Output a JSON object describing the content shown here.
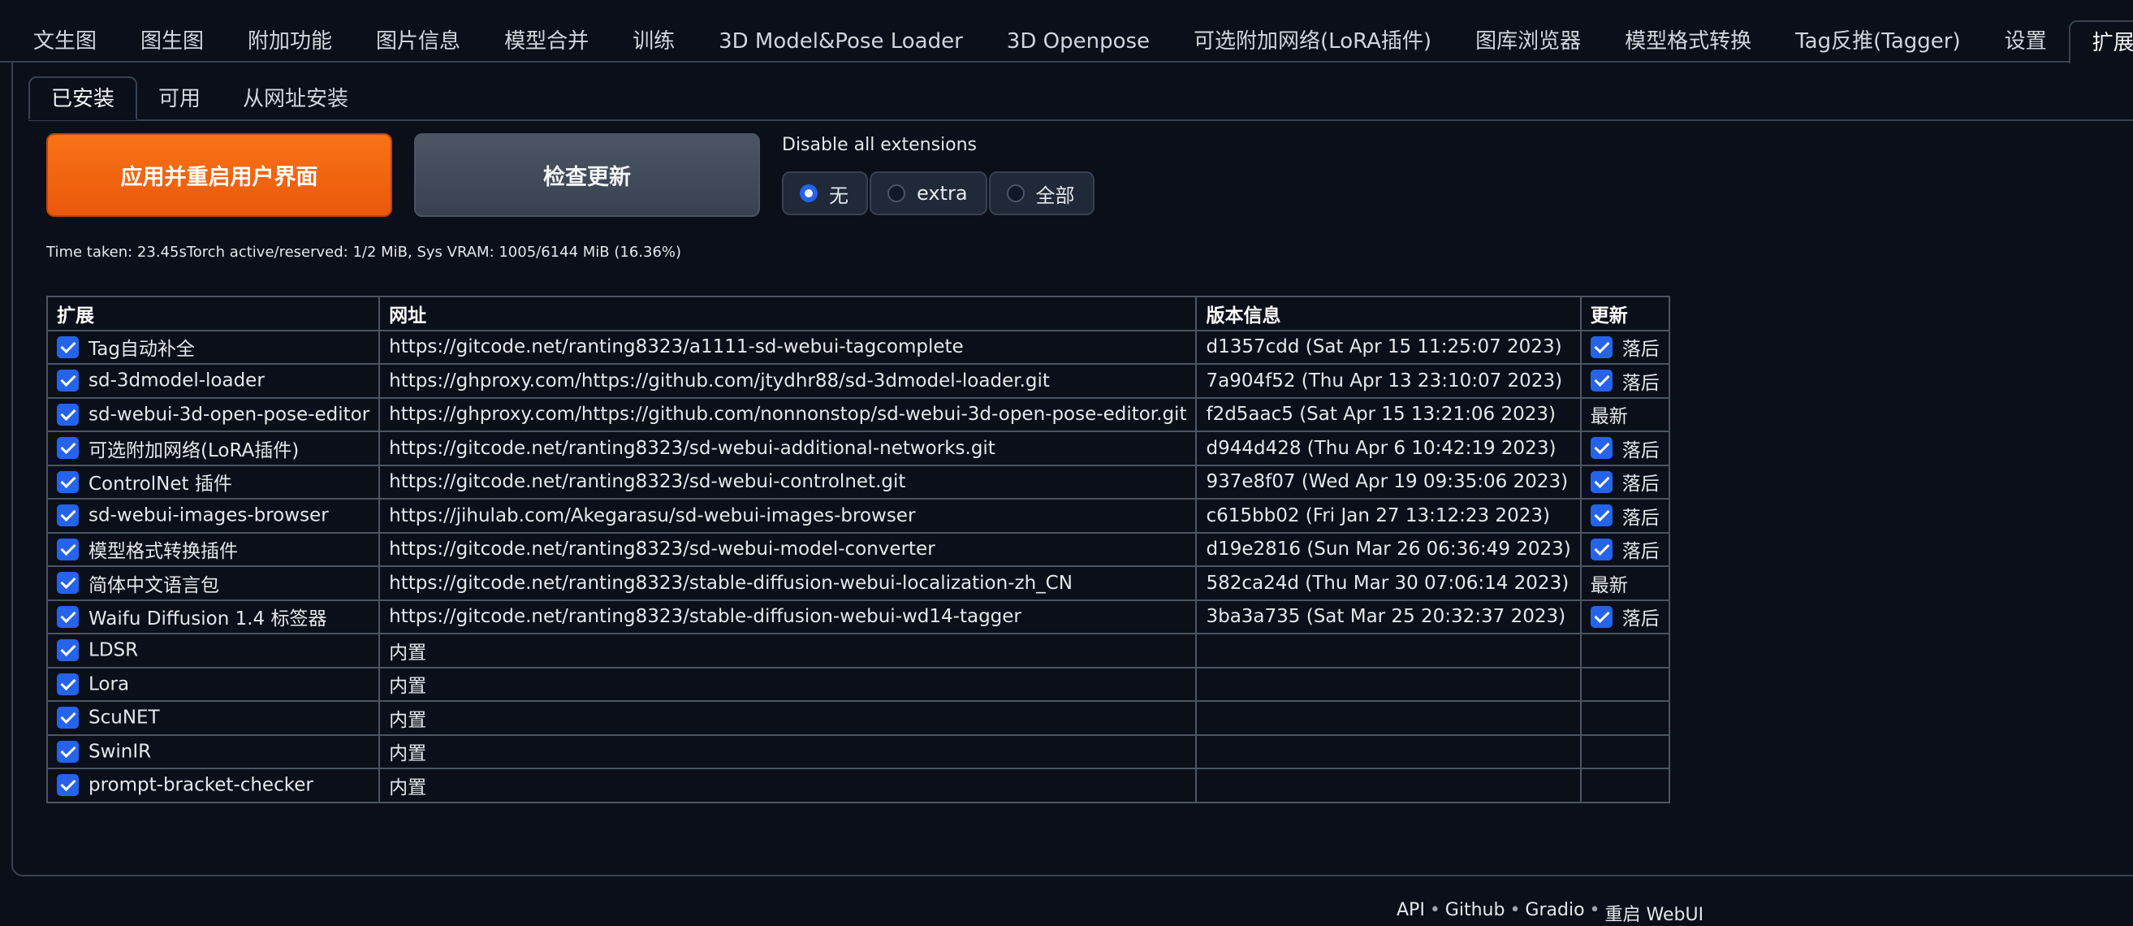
{
  "topnav": {
    "tabs": [
      "文生图",
      "图生图",
      "附加功能",
      "图片信息",
      "模型合并",
      "训练",
      "3D Model&Pose Loader",
      "3D Openpose",
      "可选附加网络(LoRA插件)",
      "图库浏览器",
      "模型格式转换",
      "Tag反推(Tagger)",
      "设置",
      "扩展"
    ],
    "active": "扩展"
  },
  "subnav": {
    "tabs": [
      "已安装",
      "可用",
      "从网址安装"
    ],
    "active": "已安装"
  },
  "buttons": {
    "apply_label": "应用并重启用户界面",
    "check_label": "检查更新"
  },
  "disable": {
    "label": "Disable all extensions",
    "options": [
      "无",
      "extra",
      "全部"
    ],
    "selected": "无"
  },
  "status_text": "Time taken: 23.45sTorch active/reserved: 1/2 MiB, Sys VRAM: 1005/6144 MiB (16.36%)",
  "table": {
    "headers": [
      "扩展",
      "网址",
      "版本信息",
      "更新"
    ],
    "rows": [
      {
        "enabled": true,
        "name": "Tag自动补全",
        "url": "https://gitcode.net/ranting8323/a1111-sd-webui-tagcomplete",
        "version": "d1357cdd (Sat Apr 15 11:25:07 2023)",
        "update_checkbox": true,
        "update": "落后"
      },
      {
        "enabled": true,
        "name": "sd-3dmodel-loader",
        "url": "https://ghproxy.com/https://github.com/jtydhr88/sd-3dmodel-loader.git",
        "version": "7a904f52 (Thu Apr 13 23:10:07 2023)",
        "update_checkbox": true,
        "update": "落后"
      },
      {
        "enabled": true,
        "name": "sd-webui-3d-open-pose-editor",
        "url": "https://ghproxy.com/https://github.com/nonnonstop/sd-webui-3d-open-pose-editor.git",
        "version": "f2d5aac5 (Sat Apr 15 13:21:06 2023)",
        "update_checkbox": false,
        "update": "最新"
      },
      {
        "enabled": true,
        "name": "可选附加网络(LoRA插件)",
        "url": "https://gitcode.net/ranting8323/sd-webui-additional-networks.git",
        "version": "d944d428 (Thu Apr 6 10:42:19 2023)",
        "update_checkbox": true,
        "update": "落后"
      },
      {
        "enabled": true,
        "name": "ControlNet 插件",
        "url": "https://gitcode.net/ranting8323/sd-webui-controlnet.git",
        "version": "937e8f07 (Wed Apr 19 09:35:06 2023)",
        "update_checkbox": true,
        "update": "落后"
      },
      {
        "enabled": true,
        "name": "sd-webui-images-browser",
        "url": "https://jihulab.com/Akegarasu/sd-webui-images-browser",
        "version": "c615bb02 (Fri Jan 27 13:12:23 2023)",
        "update_checkbox": true,
        "update": "落后"
      },
      {
        "enabled": true,
        "name": "模型格式转换插件",
        "url": "https://gitcode.net/ranting8323/sd-webui-model-converter",
        "version": "d19e2816 (Sun Mar 26 06:36:49 2023)",
        "update_checkbox": true,
        "update": "落后"
      },
      {
        "enabled": true,
        "name": "简体中文语言包",
        "url": "https://gitcode.net/ranting8323/stable-diffusion-webui-localization-zh_CN",
        "version": "582ca24d (Thu Mar 30 07:06:14 2023)",
        "update_checkbox": false,
        "update": "最新"
      },
      {
        "enabled": true,
        "name": "Waifu Diffusion 1.4 标签器",
        "url": "https://gitcode.net/ranting8323/stable-diffusion-webui-wd14-tagger",
        "version": "3ba3a735 (Sat Mar 25 20:32:37 2023)",
        "update_checkbox": true,
        "update": "落后"
      },
      {
        "enabled": true,
        "name": "LDSR",
        "url": "内置",
        "version": "",
        "update_checkbox": false,
        "update": ""
      },
      {
        "enabled": true,
        "name": "Lora",
        "url": "内置",
        "version": "",
        "update_checkbox": false,
        "update": ""
      },
      {
        "enabled": true,
        "name": "ScuNET",
        "url": "内置",
        "version": "",
        "update_checkbox": false,
        "update": ""
      },
      {
        "enabled": true,
        "name": "SwinIR",
        "url": "内置",
        "version": "",
        "update_checkbox": false,
        "update": ""
      },
      {
        "enabled": true,
        "name": "prompt-bracket-checker",
        "url": "内置",
        "version": "",
        "update_checkbox": false,
        "update": ""
      }
    ]
  },
  "footer": {
    "links": [
      "API",
      "Github",
      "Gradio",
      "重启 WebUI"
    ],
    "separator": "•"
  },
  "colors": {
    "background": "#0b0f19",
    "accent_orange": "#ea580c",
    "checkbox_blue": "#2563eb",
    "border": "#4b5563"
  }
}
